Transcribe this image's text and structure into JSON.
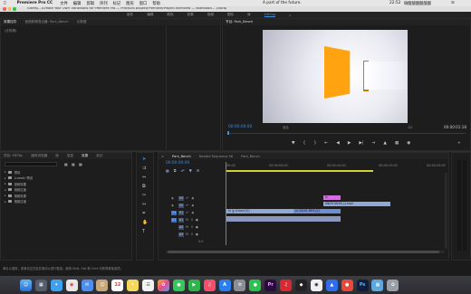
{
  "menubar": {
    "app": "Premiere Pro CC",
    "items": [
      "文件",
      "编辑",
      "剪辑",
      "序列",
      "标记",
      "图形",
      "窗口",
      "帮助"
    ],
    "now_playing": "A part of the future.",
    "clock": "22:52",
    "user": "微酸酸酸酸酸酸"
  },
  "title_strip": {
    "path": "/Users/.../Create Your Own Transitions for Premiere Pro — Practical project/Premiere/Project overview — download... .prproj"
  },
  "workspace": {
    "items": [
      "组件",
      "编辑",
      "颜色",
      "效果",
      "音频",
      "图形",
      "库",
      "Editing"
    ],
    "active_index": 7
  },
  "source_panel": {
    "tabs": [
      "效果控件",
      "音频剪辑混合器: Park_Bench",
      "元数据"
    ],
    "active_tab": 0,
    "note": "(无剪辑)"
  },
  "program_monitor": {
    "tab_label": "节目: Park_Bench",
    "timecode_left": "00:00:00:00",
    "fit": "适合",
    "scale": "1/2",
    "timecode_right": "00:00:01:18"
  },
  "project_panel": {
    "tabs": [
      "项目: METAL",
      "媒体浏览器",
      "库",
      "信息",
      "效果",
      "标记"
    ],
    "active_tab": 4,
    "search_placeholder": "",
    "items": [
      {
        "label": "预设",
        "indent": 0
      },
      {
        "label": "Lumetri 预设",
        "indent": 0
      },
      {
        "label": "音频效果",
        "indent": 0
      },
      {
        "label": "音频过渡",
        "indent": 0
      },
      {
        "label": "视频效果",
        "indent": 0
      },
      {
        "label": "视频过渡",
        "indent": 0
      }
    ]
  },
  "timeline": {
    "tabs": [
      "Park_Bench",
      "Nested Sequence 06",
      "Park_Bench"
    ],
    "active_tab": 0,
    "timecode": "00:00:00:00",
    "ruler": [
      "00:00",
      "00:00:05:00",
      "00:00:10:00",
      "00:00:15:00",
      "00:00:20:00"
    ],
    "tracks": [
      {
        "name": "V3",
        "type": "video"
      },
      {
        "name": "V2",
        "type": "video"
      },
      {
        "name": "V1",
        "type": "video"
      },
      {
        "name": "A1",
        "type": "audio"
      },
      {
        "name": "A2",
        "type": "audio"
      },
      {
        "name": "A3",
        "type": "audio"
      }
    ],
    "master_label": "0.0",
    "clips": {
      "pink_label": "fx",
      "v2_label": "SNIZ57JNVK_LJ.mp4",
      "v1_a_label": "fx 主 A.mp4 [V]",
      "v1_b_label": "fx 20191 MP4 [V]"
    }
  },
  "status_bar": {
    "text": "单击以选择，或单击空白处并拖动以进行框选。使用 Shift, Opt 和 Cmd 可获得其他选项。"
  },
  "dock": {
    "icons": [
      "finder-icon",
      "launchpad-icon",
      "safari-icon",
      "chrome-icon",
      "mail-icon",
      "contacts-icon",
      "calendar-icon",
      "notes-icon",
      "reminders-icon",
      "photos-icon",
      "messages-icon",
      "facetime-icon",
      "music-icon",
      "appstore-icon",
      "settings-icon",
      "wechat-icon",
      "premiere-icon",
      "netease-icon",
      "fcp-icon",
      "qq-icon",
      "baidu-icon",
      "weibo-icon",
      "ps-icon",
      "folder-icon",
      "trash-icon"
    ],
    "date": "12"
  },
  "colors": {
    "accent": "#3f8edc",
    "clip_video": "#8fa8d8",
    "clip_pink": "#d46fe0",
    "orange": "#ffa410"
  }
}
